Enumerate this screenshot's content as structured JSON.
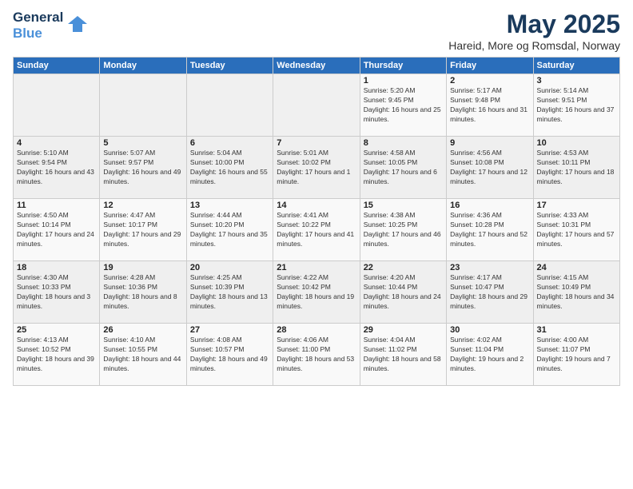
{
  "header": {
    "logo_line1": "General",
    "logo_line2": "Blue",
    "month": "May 2025",
    "location": "Hareid, More og Romsdal, Norway"
  },
  "weekdays": [
    "Sunday",
    "Monday",
    "Tuesday",
    "Wednesday",
    "Thursday",
    "Friday",
    "Saturday"
  ],
  "weeks": [
    [
      {
        "num": "",
        "sunrise": "",
        "sunset": "",
        "daylight": ""
      },
      {
        "num": "",
        "sunrise": "",
        "sunset": "",
        "daylight": ""
      },
      {
        "num": "",
        "sunrise": "",
        "sunset": "",
        "daylight": ""
      },
      {
        "num": "",
        "sunrise": "",
        "sunset": "",
        "daylight": ""
      },
      {
        "num": "1",
        "sunrise": "Sunrise: 5:20 AM",
        "sunset": "Sunset: 9:45 PM",
        "daylight": "Daylight: 16 hours and 25 minutes."
      },
      {
        "num": "2",
        "sunrise": "Sunrise: 5:17 AM",
        "sunset": "Sunset: 9:48 PM",
        "daylight": "Daylight: 16 hours and 31 minutes."
      },
      {
        "num": "3",
        "sunrise": "Sunrise: 5:14 AM",
        "sunset": "Sunset: 9:51 PM",
        "daylight": "Daylight: 16 hours and 37 minutes."
      }
    ],
    [
      {
        "num": "4",
        "sunrise": "Sunrise: 5:10 AM",
        "sunset": "Sunset: 9:54 PM",
        "daylight": "Daylight: 16 hours and 43 minutes."
      },
      {
        "num": "5",
        "sunrise": "Sunrise: 5:07 AM",
        "sunset": "Sunset: 9:57 PM",
        "daylight": "Daylight: 16 hours and 49 minutes."
      },
      {
        "num": "6",
        "sunrise": "Sunrise: 5:04 AM",
        "sunset": "Sunset: 10:00 PM",
        "daylight": "Daylight: 16 hours and 55 minutes."
      },
      {
        "num": "7",
        "sunrise": "Sunrise: 5:01 AM",
        "sunset": "Sunset: 10:02 PM",
        "daylight": "Daylight: 17 hours and 1 minute."
      },
      {
        "num": "8",
        "sunrise": "Sunrise: 4:58 AM",
        "sunset": "Sunset: 10:05 PM",
        "daylight": "Daylight: 17 hours and 6 minutes."
      },
      {
        "num": "9",
        "sunrise": "Sunrise: 4:56 AM",
        "sunset": "Sunset: 10:08 PM",
        "daylight": "Daylight: 17 hours and 12 minutes."
      },
      {
        "num": "10",
        "sunrise": "Sunrise: 4:53 AM",
        "sunset": "Sunset: 10:11 PM",
        "daylight": "Daylight: 17 hours and 18 minutes."
      }
    ],
    [
      {
        "num": "11",
        "sunrise": "Sunrise: 4:50 AM",
        "sunset": "Sunset: 10:14 PM",
        "daylight": "Daylight: 17 hours and 24 minutes."
      },
      {
        "num": "12",
        "sunrise": "Sunrise: 4:47 AM",
        "sunset": "Sunset: 10:17 PM",
        "daylight": "Daylight: 17 hours and 29 minutes."
      },
      {
        "num": "13",
        "sunrise": "Sunrise: 4:44 AM",
        "sunset": "Sunset: 10:20 PM",
        "daylight": "Daylight: 17 hours and 35 minutes."
      },
      {
        "num": "14",
        "sunrise": "Sunrise: 4:41 AM",
        "sunset": "Sunset: 10:22 PM",
        "daylight": "Daylight: 17 hours and 41 minutes."
      },
      {
        "num": "15",
        "sunrise": "Sunrise: 4:38 AM",
        "sunset": "Sunset: 10:25 PM",
        "daylight": "Daylight: 17 hours and 46 minutes."
      },
      {
        "num": "16",
        "sunrise": "Sunrise: 4:36 AM",
        "sunset": "Sunset: 10:28 PM",
        "daylight": "Daylight: 17 hours and 52 minutes."
      },
      {
        "num": "17",
        "sunrise": "Sunrise: 4:33 AM",
        "sunset": "Sunset: 10:31 PM",
        "daylight": "Daylight: 17 hours and 57 minutes."
      }
    ],
    [
      {
        "num": "18",
        "sunrise": "Sunrise: 4:30 AM",
        "sunset": "Sunset: 10:33 PM",
        "daylight": "Daylight: 18 hours and 3 minutes."
      },
      {
        "num": "19",
        "sunrise": "Sunrise: 4:28 AM",
        "sunset": "Sunset: 10:36 PM",
        "daylight": "Daylight: 18 hours and 8 minutes."
      },
      {
        "num": "20",
        "sunrise": "Sunrise: 4:25 AM",
        "sunset": "Sunset: 10:39 PM",
        "daylight": "Daylight: 18 hours and 13 minutes."
      },
      {
        "num": "21",
        "sunrise": "Sunrise: 4:22 AM",
        "sunset": "Sunset: 10:42 PM",
        "daylight": "Daylight: 18 hours and 19 minutes."
      },
      {
        "num": "22",
        "sunrise": "Sunrise: 4:20 AM",
        "sunset": "Sunset: 10:44 PM",
        "daylight": "Daylight: 18 hours and 24 minutes."
      },
      {
        "num": "23",
        "sunrise": "Sunrise: 4:17 AM",
        "sunset": "Sunset: 10:47 PM",
        "daylight": "Daylight: 18 hours and 29 minutes."
      },
      {
        "num": "24",
        "sunrise": "Sunrise: 4:15 AM",
        "sunset": "Sunset: 10:49 PM",
        "daylight": "Daylight: 18 hours and 34 minutes."
      }
    ],
    [
      {
        "num": "25",
        "sunrise": "Sunrise: 4:13 AM",
        "sunset": "Sunset: 10:52 PM",
        "daylight": "Daylight: 18 hours and 39 minutes."
      },
      {
        "num": "26",
        "sunrise": "Sunrise: 4:10 AM",
        "sunset": "Sunset: 10:55 PM",
        "daylight": "Daylight: 18 hours and 44 minutes."
      },
      {
        "num": "27",
        "sunrise": "Sunrise: 4:08 AM",
        "sunset": "Sunset: 10:57 PM",
        "daylight": "Daylight: 18 hours and 49 minutes."
      },
      {
        "num": "28",
        "sunrise": "Sunrise: 4:06 AM",
        "sunset": "Sunset: 11:00 PM",
        "daylight": "Daylight: 18 hours and 53 minutes."
      },
      {
        "num": "29",
        "sunrise": "Sunrise: 4:04 AM",
        "sunset": "Sunset: 11:02 PM",
        "daylight": "Daylight: 18 hours and 58 minutes."
      },
      {
        "num": "30",
        "sunrise": "Sunrise: 4:02 AM",
        "sunset": "Sunset: 11:04 PM",
        "daylight": "Daylight: 19 hours and 2 minutes."
      },
      {
        "num": "31",
        "sunrise": "Sunrise: 4:00 AM",
        "sunset": "Sunset: 11:07 PM",
        "daylight": "Daylight: 19 hours and 7 minutes."
      }
    ]
  ]
}
